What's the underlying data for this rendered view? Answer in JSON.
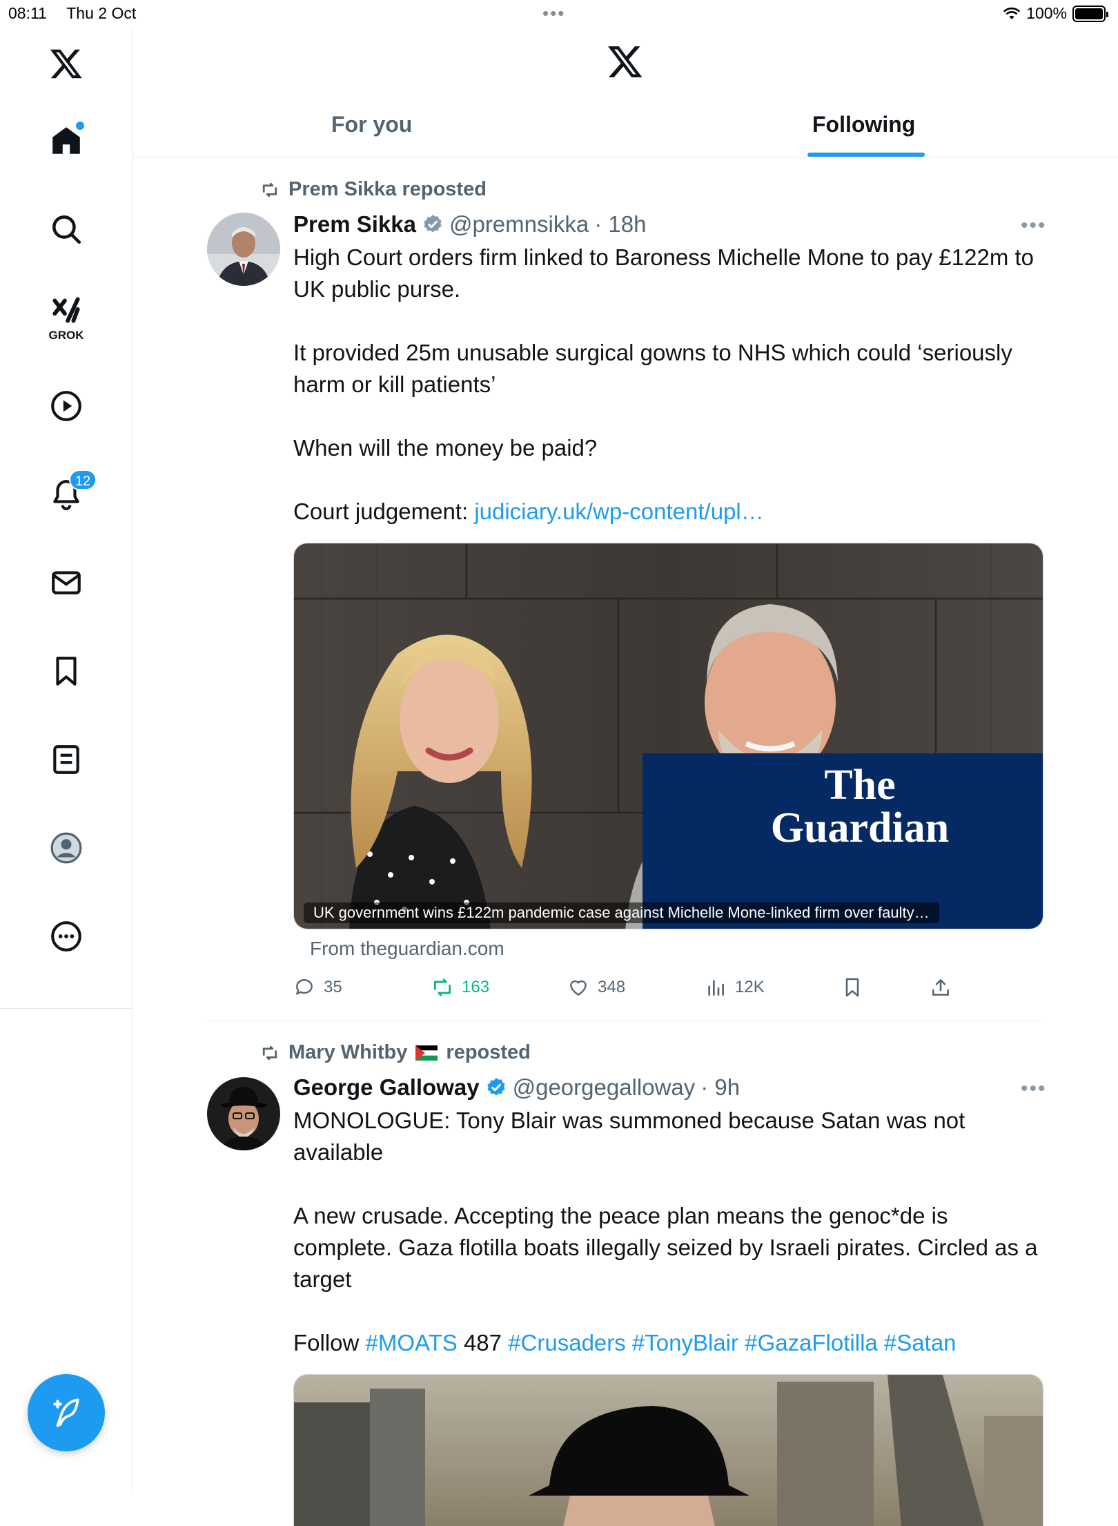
{
  "status_bar": {
    "time": "08:11",
    "date": "Thu 2 Oct",
    "dots": "•••",
    "battery": "100%"
  },
  "sidebar": {
    "items": [
      {
        "icon": "x-logo-icon"
      },
      {
        "icon": "home-icon"
      },
      {
        "icon": "search-icon"
      },
      {
        "icon": "grok-icon",
        "label": "GROK"
      },
      {
        "icon": "video-play-icon"
      },
      {
        "icon": "bell-icon",
        "badge": "12"
      },
      {
        "icon": "mail-icon"
      },
      {
        "icon": "bookmark-icon"
      },
      {
        "icon": "lists-icon"
      },
      {
        "icon": "profile-icon"
      },
      {
        "icon": "more-icon"
      }
    ],
    "compose_icon": "compose-icon"
  },
  "header": {
    "tabs": [
      {
        "label": "For you",
        "active": false
      },
      {
        "label": "Following",
        "active": true
      }
    ]
  },
  "colors": {
    "accent": "#1d9bf0",
    "secondary_text": "#536471",
    "retweet_green": "#00ba7c",
    "border": "#e6e9eb"
  },
  "tweets": [
    {
      "reposted_by": "Prem Sikka reposted",
      "author_name": "Prem Sikka",
      "handle": "@premnsikka",
      "time": "· 18h",
      "paragraphs": [
        "High Court orders firm linked to Baroness Michelle Mone to pay £122m to UK public purse.",
        "It provided 25m unusable surgical gowns to NHS  which could ‘seriously harm or kill patients’",
        "When will the money be paid?"
      ],
      "link_prefix": "Court judgement: ",
      "link_text": "judiciary.uk/wp-content/upl…",
      "card": {
        "caption": "UK government wins £122m pandemic case against Michelle Mone-linked firm over faulty…",
        "logo_line1": "The",
        "logo_line2": "Guardian",
        "from": "From theguardian.com"
      },
      "actions": {
        "replies": "35",
        "reposts": "163",
        "likes": "348",
        "views": "12K"
      }
    },
    {
      "reposted_by_name": "Mary Whitby",
      "reposted_suffix": "reposted",
      "author_name": "George Galloway",
      "handle": "@georgegalloway",
      "time": "· 9h",
      "paragraphs": [
        "MONOLOGUE: Tony Blair was summoned because Satan was not available",
        "A new crusade. Accepting the peace plan means the genoc*de is complete. Gaza flotilla boats illegally seized by Israeli pirates. Circled as a target"
      ],
      "follow_line": {
        "prefix": "Follow ",
        "tag1": "#MOATS",
        "number": " 487 ",
        "tags": "#Crusaders #TonyBlair #GazaFlotilla #Satan"
      }
    }
  ]
}
